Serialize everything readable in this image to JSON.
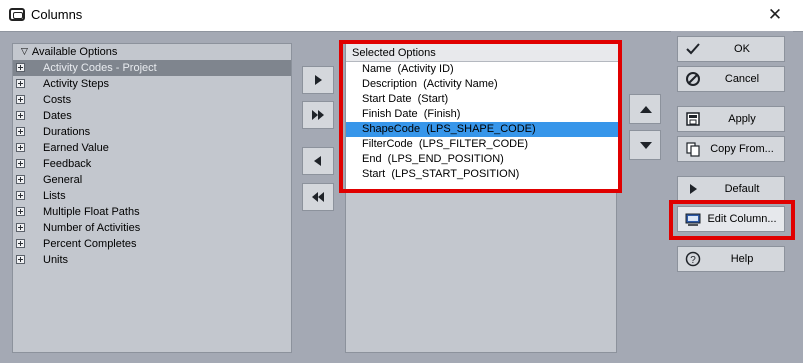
{
  "window": {
    "title": "Columns",
    "close_icon": "close-icon"
  },
  "available": {
    "header": "Available Options",
    "items": [
      {
        "label": "Activity Codes - Project",
        "selected": true
      },
      {
        "label": "Activity Steps"
      },
      {
        "label": "Costs"
      },
      {
        "label": "Dates"
      },
      {
        "label": "Durations"
      },
      {
        "label": "Earned Value"
      },
      {
        "label": "Feedback"
      },
      {
        "label": "General"
      },
      {
        "label": "Lists"
      },
      {
        "label": "Multiple Float Paths"
      },
      {
        "label": "Number of Activities"
      },
      {
        "label": "Percent Completes"
      },
      {
        "label": "Units"
      }
    ]
  },
  "transfer": {
    "add_icon": "arrow-right-icon",
    "add_all_icon": "double-arrow-right-icon",
    "remove_icon": "arrow-left-icon",
    "remove_all_icon": "double-arrow-left-icon"
  },
  "selected": {
    "header": "Selected Options",
    "items": [
      {
        "label": "Name  (Activity ID)"
      },
      {
        "label": "Description  (Activity Name)"
      },
      {
        "label": "Start Date  (Start)"
      },
      {
        "label": "Finish Date  (Finish)"
      },
      {
        "label": "ShapeCode  (LPS_SHAPE_CODE)",
        "selected": true
      },
      {
        "label": "FilterCode  (LPS_FILTER_CODE)"
      },
      {
        "label": "End  (LPS_END_POSITION)"
      },
      {
        "label": "Start  (LPS_START_POSITION)"
      }
    ]
  },
  "order": {
    "up_icon": "arrow-up-icon",
    "down_icon": "arrow-down-icon"
  },
  "buttons": {
    "ok": "OK",
    "cancel": "Cancel",
    "apply": "Apply",
    "copy_from": "Copy From...",
    "default": "Default",
    "edit_column": "Edit Column...",
    "help": "Help"
  },
  "highlight_color": "#e00000",
  "selection_color": "#3796ea"
}
